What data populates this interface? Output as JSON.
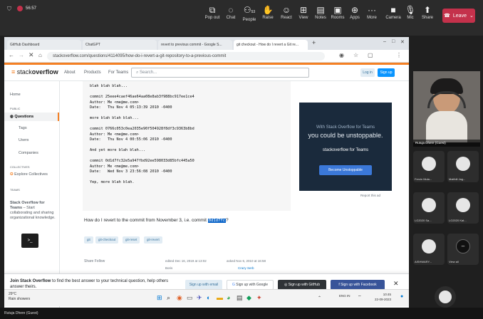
{
  "teams": {
    "time": "56:57",
    "buttons": [
      {
        "label": "Pop out"
      },
      {
        "label": "Chat"
      },
      {
        "label": "People",
        "count": "53"
      },
      {
        "label": "Raise"
      },
      {
        "label": "React"
      },
      {
        "label": "View"
      },
      {
        "label": "Notes"
      },
      {
        "label": "Rooms"
      },
      {
        "label": "Apps"
      },
      {
        "label": "More"
      },
      {
        "label": "Camera"
      },
      {
        "label": "Mic"
      },
      {
        "label": "Share"
      }
    ],
    "leave_label": "Leave",
    "presenter_name": "Rutuja Dhere (Guest)",
    "participants": [
      {
        "name": "Fercin Mula..."
      },
      {
        "name": "Maithili Jag..."
      },
      {
        "name": "LG2020 Sa..."
      },
      {
        "name": "LG2020 Kat..."
      },
      {
        "name": "AISHWARY..."
      }
    ],
    "view_all_label": "View all",
    "bottom_label": "Rutuja Dhere (Guest)"
  },
  "browser": {
    "tabs": [
      {
        "label": "GitHub Dashboard"
      },
      {
        "label": "ChatGPT"
      },
      {
        "label": "revert to previous commit - Google S..."
      },
      {
        "label": "git checkout - How do I revert a Git re..."
      }
    ],
    "url": "stackoverflow.com/questions/4114095/how-do-i-revert-a-git-repository-to-a-previous-commit"
  },
  "so": {
    "logo_prefix": "stack",
    "logo_bold": "overflow",
    "nav": [
      "About",
      "Products",
      "For Teams"
    ],
    "search_placeholder": "Search...",
    "login": "Log in",
    "signup": "Sign up",
    "sidebar": {
      "home": "Home",
      "public": "PUBLIC",
      "questions": "Questions",
      "tags": "Tags",
      "users": "Users",
      "companies": "Companies",
      "collectives": "COLLECTIVES",
      "explore": "Explore Collectives",
      "teams": "TEAMS",
      "teams_title": "Stack Overflow for Teams",
      "teams_desc": "– Start collaborating and sharing organizational knowledge."
    },
    "code_lines": [
      "blah blah blah...",
      "",
      "commit 25eee4caef46ae64aa08e8ab3f988bc917ee1ce4",
      "Author: Me <me@me.com>",
      "Date:   Thu Nov 4 05:13:39 2010 -0400",
      "",
      "more blah blah blah...",
      "",
      "commit 0766c053c0ea2035e90f504928f8df3c9363b8bd",
      "Author: Me <me@me.com>",
      "Date:   Thu Nov 4 00:55:06 2010 -0400",
      "",
      "And yet more blah blah...",
      "",
      "commit 0d1d7fc32e5a947fbd92ee598033d85bfc445a50",
      "Author: Me <me@me.com>",
      "Date:   Wed Nov 3 23:56:08 2010 -0400",
      "",
      "Yep, more blah blah."
    ],
    "question_text": "How do I revert to the commit from November 3, i.e. commit",
    "question_commit": "0d1d7fc",
    "question_end": "?",
    "tags": [
      "git",
      "git-checkout",
      "git-reset",
      "git-revert"
    ],
    "share": "Share  Follow",
    "edited": "edited Dec 16, 2019 at 13:02",
    "asked": "asked Nov 6, 2010 at 16:58",
    "editor": "Boris",
    "asker": "Crazy Serb",
    "ad": {
      "sub": "With Stack Overflow for Teams",
      "head": "you could be unstoppable.",
      "logo": "stackoverflow for Teams",
      "button": "Become Unstoppable",
      "report": "Report this ad"
    },
    "join": {
      "bold": "Join Stack Overflow",
      "text": " to find the best answer to your technical question, help others answer theirs.",
      "email": "Sign up with email",
      "google": "Sign up with Google",
      "github": "Sign up with GitHub",
      "facebook": "Sign up with Facebook"
    }
  },
  "taskbar": {
    "weather_temp": "29°C",
    "weather_desc": "Rain showers",
    "time": "10:45",
    "date": "22-09-2023",
    "lang": "ENG IN"
  },
  "colors": {
    "so_orange": "#f48024",
    "so_blue": "#0a95ff",
    "teams_leave": "#c4314b"
  }
}
